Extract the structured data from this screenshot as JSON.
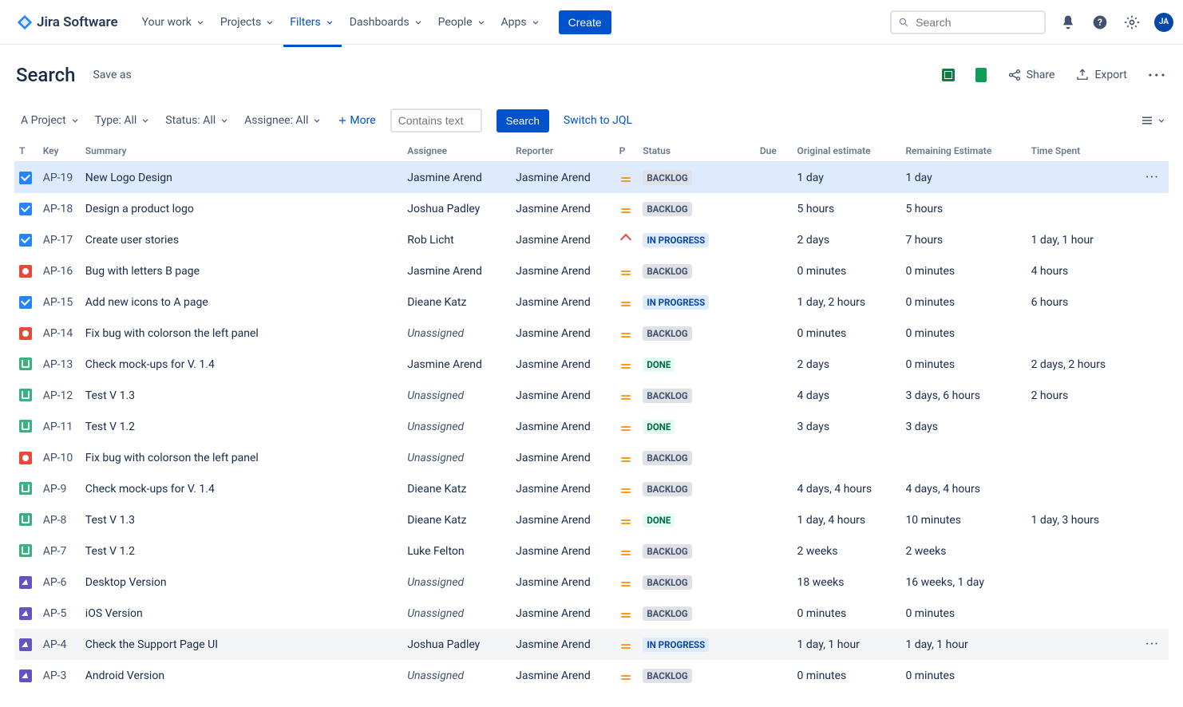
{
  "nav": {
    "product": "Jira Software",
    "items": [
      {
        "label": "Your work"
      },
      {
        "label": "Projects"
      },
      {
        "label": "Filters",
        "active": true
      },
      {
        "label": "Dashboards"
      },
      {
        "label": "People"
      },
      {
        "label": "Apps"
      }
    ],
    "create": "Create",
    "search_placeholder": "Search",
    "avatar": "JA"
  },
  "header": {
    "title": "Search",
    "save_as": "Save as",
    "share": "Share",
    "export": "Export"
  },
  "filters": {
    "project": "A Project",
    "type": "Type: All",
    "status": "Status: All",
    "assignee": "Assignee: All",
    "more": "More",
    "contains_placeholder": "Contains text",
    "search_btn": "Search",
    "switch_jql": "Switch to JQL"
  },
  "columns": {
    "type": "T",
    "key": "Key",
    "summary": "Summary",
    "assignee": "Assignee",
    "reporter": "Reporter",
    "priority": "P",
    "status": "Status",
    "due": "Due",
    "original_estimate": "Original estimate",
    "remaining_estimate": "Remaining Estimate",
    "time_spent": "Time Spent"
  },
  "issues": [
    {
      "type": "task",
      "key": "AP-19",
      "summary": "New Logo Design",
      "assignee": "Jasmine Arend",
      "reporter": "Jasmine Arend",
      "priority": "medium",
      "status": "BACKLOG",
      "due": "",
      "orig": "1 day",
      "rem": "1 day",
      "spent": "",
      "selected": true
    },
    {
      "type": "task",
      "key": "AP-18",
      "summary": "Design a product logo",
      "assignee": "Joshua Padley",
      "reporter": "Jasmine Arend",
      "priority": "medium",
      "status": "BACKLOG",
      "due": "",
      "orig": "5 hours",
      "rem": "5 hours",
      "spent": ""
    },
    {
      "type": "task",
      "key": "AP-17",
      "summary": "Create user stories",
      "assignee": "Rob Licht",
      "reporter": "Jasmine Arend",
      "priority": "high",
      "status": "IN PROGRESS",
      "due": "",
      "orig": "2 days",
      "rem": "7 hours",
      "spent": "1 day, 1 hour"
    },
    {
      "type": "bug",
      "key": "AP-16",
      "summary": "Bug with letters B page",
      "assignee": "Jasmine Arend",
      "reporter": "Jasmine Arend",
      "priority": "medium",
      "status": "BACKLOG",
      "due": "",
      "orig": "0 minutes",
      "rem": "0 minutes",
      "spent": "4 hours"
    },
    {
      "type": "task",
      "key": "AP-15",
      "summary": "Add new icons to A page",
      "assignee": "Dieane Katz",
      "reporter": "Jasmine Arend",
      "priority": "medium",
      "status": "IN PROGRESS",
      "due": "",
      "orig": "1 day, 2 hours",
      "rem": "0 minutes",
      "spent": "6 hours"
    },
    {
      "type": "bug",
      "key": "AP-14",
      "summary": "Fix bug with colorson the left panel",
      "assignee": "Unassigned",
      "reporter": "Jasmine Arend",
      "priority": "medium",
      "status": "BACKLOG",
      "due": "",
      "orig": "0 minutes",
      "rem": "0 minutes",
      "spent": ""
    },
    {
      "type": "story",
      "key": "AP-13",
      "summary": "Check mock-ups for V. 1.4",
      "assignee": "Jasmine Arend",
      "reporter": "Jasmine Arend",
      "priority": "medium",
      "status": "DONE",
      "due": "",
      "orig": "2 days",
      "rem": "0 minutes",
      "spent": "2 days, 2 hours"
    },
    {
      "type": "story",
      "key": "AP-12",
      "summary": "Test V 1.3",
      "assignee": "Unassigned",
      "reporter": "Jasmine Arend",
      "priority": "medium",
      "status": "BACKLOG",
      "due": "",
      "orig": "4 days",
      "rem": "3 days, 6 hours",
      "spent": "2 hours"
    },
    {
      "type": "story",
      "key": "AP-11",
      "summary": "Test V 1.2",
      "assignee": "Unassigned",
      "reporter": "Jasmine Arend",
      "priority": "medium",
      "status": "DONE",
      "due": "",
      "orig": "3 days",
      "rem": "3 days",
      "spent": ""
    },
    {
      "type": "bug",
      "key": "AP-10",
      "summary": "Fix bug with colorson the left panel",
      "assignee": "Unassigned",
      "reporter": "Jasmine Arend",
      "priority": "medium",
      "status": "BACKLOG",
      "due": "",
      "orig": "",
      "rem": "",
      "spent": ""
    },
    {
      "type": "story",
      "key": "AP-9",
      "summary": "Check mock-ups for V. 1.4",
      "assignee": "Dieane Katz",
      "reporter": "Jasmine Arend",
      "priority": "medium",
      "status": "BACKLOG",
      "due": "",
      "orig": "4 days, 4 hours",
      "rem": "4 days, 4 hours",
      "spent": ""
    },
    {
      "type": "story",
      "key": "AP-8",
      "summary": "Test V 1.3",
      "assignee": "Dieane Katz",
      "reporter": "Jasmine Arend",
      "priority": "medium",
      "status": "DONE",
      "due": "",
      "orig": "1 day, 4 hours",
      "rem": "10 minutes",
      "spent": "1 day, 3 hours"
    },
    {
      "type": "story",
      "key": "AP-7",
      "summary": "Test V 1.2",
      "assignee": "Luke Felton",
      "reporter": "Jasmine Arend",
      "priority": "medium",
      "status": "BACKLOG",
      "due": "",
      "orig": "2 weeks",
      "rem": "2 weeks",
      "spent": ""
    },
    {
      "type": "epic",
      "key": "AP-6",
      "summary": "Desktop Version",
      "assignee": "Unassigned",
      "reporter": "Jasmine Arend",
      "priority": "medium",
      "status": "BACKLOG",
      "due": "",
      "orig": "18 weeks",
      "rem": "16 weeks, 1 day",
      "spent": ""
    },
    {
      "type": "epic",
      "key": "AP-5",
      "summary": "iOS Version",
      "assignee": "Unassigned",
      "reporter": "Jasmine Arend",
      "priority": "medium",
      "status": "BACKLOG",
      "due": "",
      "orig": "0 minutes",
      "rem": "0 minutes",
      "spent": ""
    },
    {
      "type": "epic",
      "key": "AP-4",
      "summary": "Check the Support Page UI",
      "assignee": "Joshua Padley",
      "reporter": "Jasmine Arend",
      "priority": "medium",
      "status": "IN PROGRESS",
      "due": "",
      "orig": "1 day, 1 hour",
      "rem": "1 day, 1 hour",
      "spent": "",
      "hover": true
    },
    {
      "type": "epic",
      "key": "AP-3",
      "summary": "Android Version",
      "assignee": "Unassigned",
      "reporter": "Jasmine Arend",
      "priority": "medium",
      "status": "BACKLOG",
      "due": "",
      "orig": "0 minutes",
      "rem": "0 minutes",
      "spent": ""
    }
  ]
}
